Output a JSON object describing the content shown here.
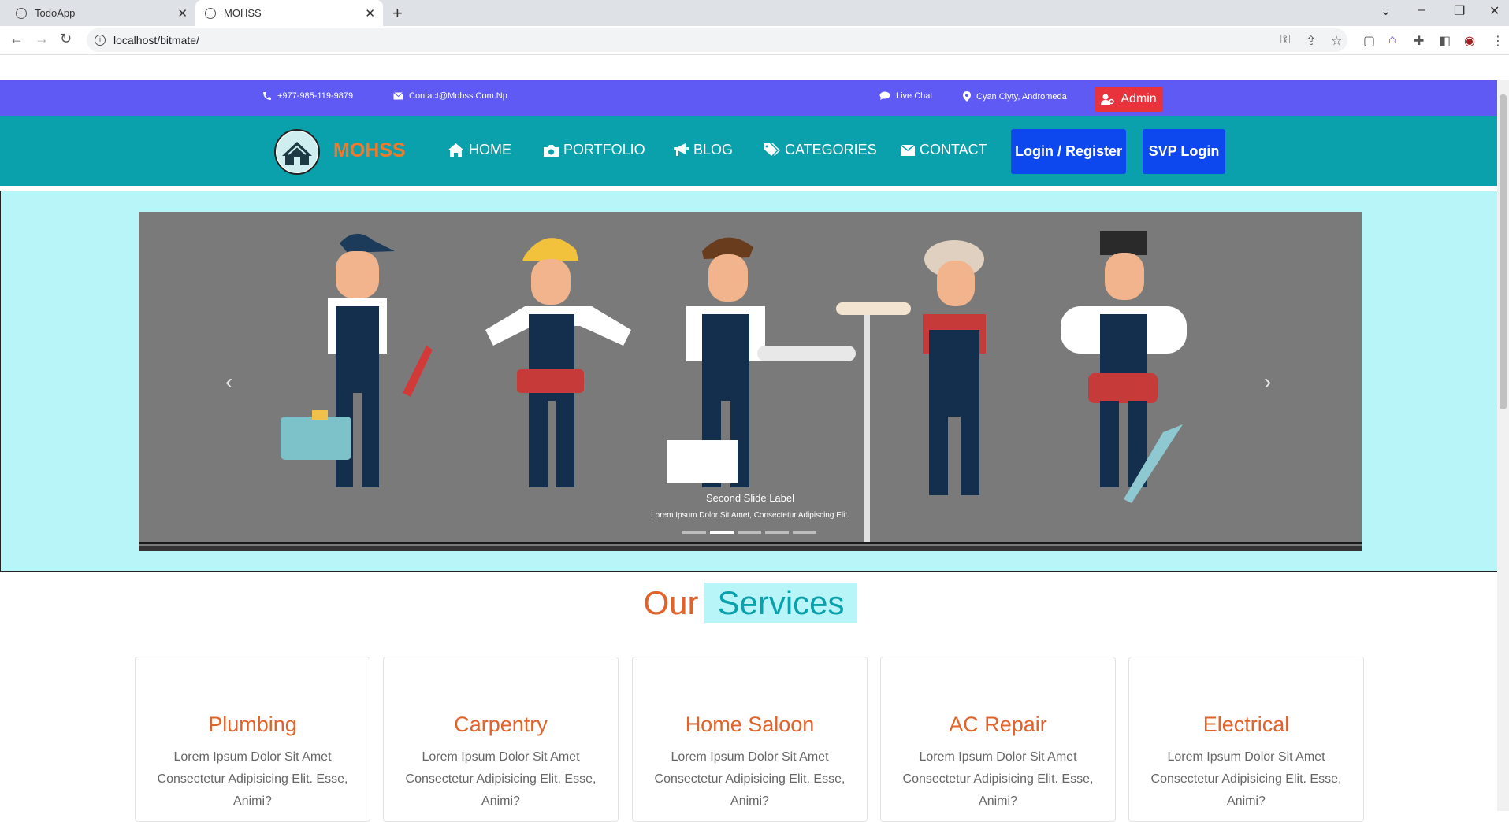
{
  "browser": {
    "tabs": [
      {
        "title": "TodoApp"
      },
      {
        "title": "MOHSS"
      }
    ],
    "url": "localhost/bitmate/"
  },
  "topbar": {
    "phone": "+977-985-119-9879",
    "email": "Contact@Mohss.Com.Np",
    "live_chat": "Live Chat",
    "location": "Cyan Ciyty, Andromeda",
    "admin": "Admin"
  },
  "nav": {
    "brand": "MOHSS",
    "links": [
      "HOME",
      "PORTFOLIO",
      "BLOG",
      "CATEGORIES",
      "CONTACT"
    ],
    "login_register": "Login / Register",
    "svp_login": "SVP Login"
  },
  "carousel": {
    "caption_title": "Second Slide Label",
    "caption_text": "Lorem Ipsum Dolor Sit Amet, Consectetur Adipiscing Elit.",
    "slide_count": 5,
    "active_index": 1
  },
  "services": {
    "title_word1": "Our",
    "title_word2": "Services",
    "cards": [
      {
        "title": "Plumbing",
        "text": "Lorem Ipsum Dolor Sit Amet Consectetur Adipisicing Elit. Esse, Animi?"
      },
      {
        "title": "Carpentry",
        "text": "Lorem Ipsum Dolor Sit Amet Consectetur Adipisicing Elit. Esse, Animi?"
      },
      {
        "title": "Home Saloon",
        "text": "Lorem Ipsum Dolor Sit Amet Consectetur Adipisicing Elit. Esse, Animi?"
      },
      {
        "title": "AC Repair",
        "text": "Lorem Ipsum Dolor Sit Amet Consectetur Adipisicing Elit. Esse, Animi?"
      },
      {
        "title": "Electrical",
        "text": "Lorem Ipsum Dolor Sit Amet Consectetur Adipisicing Elit. Esse, Animi?"
      }
    ]
  },
  "colors": {
    "infobar": "#5e5af3",
    "nav": "#0aa1ad",
    "brand": "#f07a2b",
    "accent_orange": "#e2622a",
    "hero_bg": "#b8f5f9",
    "button_blue": "#0d48ef",
    "admin_red": "#e8323c"
  }
}
